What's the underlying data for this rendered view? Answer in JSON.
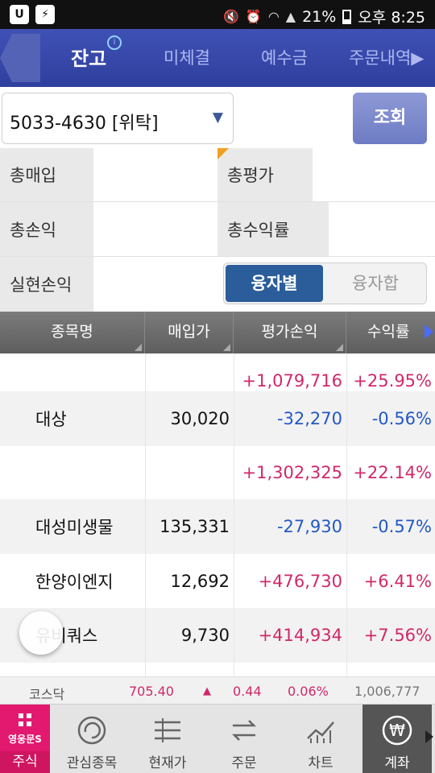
{
  "status_bar": {
    "left_icons": [
      "u-icon",
      "notification-icon"
    ],
    "battery": "21%",
    "time": "오후 8:25"
  },
  "tabs": [
    {
      "label": "잔고",
      "active": true
    },
    {
      "label": "미체결",
      "active": false
    },
    {
      "label": "예수금",
      "active": false
    },
    {
      "label": "주문내역▶",
      "active": false
    }
  ],
  "account": {
    "selected": "5033-4630 [위탁]",
    "query_label": "조회"
  },
  "summary": {
    "total_buy_label": "총매입",
    "total_eval_label": "총평가",
    "total_pnl_label": "총손익",
    "total_return_label": "총수익률",
    "realized_pnl_label": "실현손익",
    "toggle": {
      "selected": "융자별",
      "other": "융자합"
    }
  },
  "table": {
    "headers": [
      "종목명",
      "매입가",
      "평가손익",
      "수익률"
    ],
    "rows": [
      {
        "name": "",
        "price": "",
        "pnl": "+1,079,716",
        "rate": "+25.95%",
        "sign": "pos"
      },
      {
        "name": "대상",
        "price": "30,020",
        "pnl": "-32,270",
        "rate": "-0.56%",
        "sign": "neg"
      },
      {
        "name": "",
        "price": "",
        "pnl": "+1,302,325",
        "rate": "+22.14%",
        "sign": "pos"
      },
      {
        "name": "대성미생물",
        "price": "135,331",
        "pnl": "-27,930",
        "rate": "-0.57%",
        "sign": "neg"
      },
      {
        "name": "한양이엔지",
        "price": "12,692",
        "pnl": "+476,730",
        "rate": "+6.41%",
        "sign": "pos"
      },
      {
        "name": "유비쿼스",
        "price": "9,730",
        "pnl": "+414,934",
        "rate": "+7.56%",
        "sign": "pos"
      }
    ]
  },
  "ticker": {
    "name": "코스닥",
    "value": "705.40",
    "arrow": "▲",
    "change": "0.44",
    "percent": "0.06%",
    "volume": "1,006,777"
  },
  "bottom_nav": {
    "brand": "영웅문S",
    "items": [
      "주식",
      "관심종목",
      "현재가",
      "주문",
      "차트",
      "계좌"
    ]
  },
  "colors": {
    "tab_bar": "#3f51b5",
    "positive": "#d0286a",
    "negative": "#2358c4",
    "brand": "#e2196e"
  }
}
